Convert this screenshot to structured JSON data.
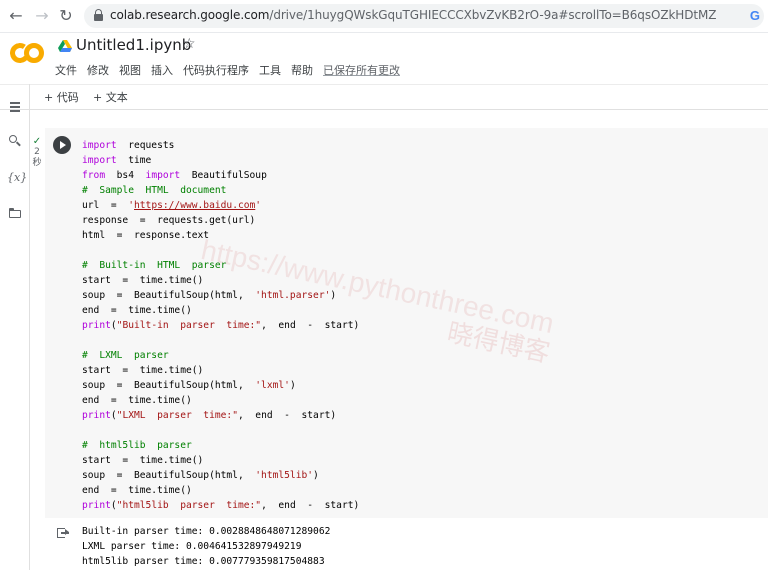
{
  "browser": {
    "back": "←",
    "forward": "→",
    "reload": "↻",
    "url_host": "colab.research.google.com",
    "url_path": "/drive/1huygQWskGquTGHIECCCXbvZvKB2rO-9a#scrollTo=B6qsOZkHDtMZ",
    "g_label": "G"
  },
  "header": {
    "notebook_title": "Untitled1.ipynb",
    "star": "☆",
    "menu": [
      "文件",
      "修改",
      "视图",
      "插入",
      "代码执行程序",
      "工具",
      "帮助"
    ],
    "saved_status": "已保存所有更改"
  },
  "toolbar": {
    "add_code": "+ 代码",
    "add_text": "+ 文本"
  },
  "rail": {
    "variables_label": "{x}"
  },
  "cell": {
    "status_check": "✓",
    "status_seconds": "2",
    "status_unit": "秒"
  },
  "code_lines": [
    [
      [
        "kw",
        "import"
      ],
      [
        "",
        "  requests"
      ]
    ],
    [
      [
        "kw",
        "import"
      ],
      [
        "",
        "  time"
      ]
    ],
    [
      [
        "kw",
        "from"
      ],
      [
        "",
        "  bs4  "
      ],
      [
        "kw",
        "import"
      ],
      [
        "",
        "  BeautifulSoup"
      ]
    ],
    [
      [
        "cm",
        "#  Sample  HTML  document"
      ]
    ],
    [
      [
        "",
        "url  =  "
      ],
      [
        "st",
        "'"
      ],
      [
        "lk",
        "https://www.baidu.com"
      ],
      [
        "st",
        "'"
      ]
    ],
    [
      [
        "",
        "response  =  requests.get(url)"
      ]
    ],
    [
      [
        "",
        "html  =  response.text"
      ]
    ],
    [
      [
        "",
        ""
      ]
    ],
    [
      [
        "cm",
        "#  Built-in  HTML  parser"
      ]
    ],
    [
      [
        "",
        "start  =  time.time()"
      ]
    ],
    [
      [
        "",
        "soup  =  BeautifulSoup(html,  "
      ],
      [
        "st",
        "'html.parser'"
      ],
      [
        "",
        ")"
      ]
    ],
    [
      [
        "",
        "end  =  time.time()"
      ]
    ],
    [
      [
        "kw",
        "print"
      ],
      [
        "",
        "("
      ],
      [
        "st",
        "\"Built-in  parser  time:\""
      ],
      [
        "",
        ",  end  -  start)"
      ]
    ],
    [
      [
        "",
        ""
      ]
    ],
    [
      [
        "cm",
        "#  LXML  parser"
      ]
    ],
    [
      [
        "",
        "start  =  time.time()"
      ]
    ],
    [
      [
        "",
        "soup  =  BeautifulSoup(html,  "
      ],
      [
        "st",
        "'lxml'"
      ],
      [
        "",
        ")"
      ]
    ],
    [
      [
        "",
        "end  =  time.time()"
      ]
    ],
    [
      [
        "kw",
        "print"
      ],
      [
        "",
        "("
      ],
      [
        "st",
        "\"LXML  parser  time:\""
      ],
      [
        "",
        ",  end  -  start)"
      ]
    ],
    [
      [
        "",
        ""
      ]
    ],
    [
      [
        "cm",
        "#  html5lib  parser"
      ]
    ],
    [
      [
        "",
        "start  =  time.time()"
      ]
    ],
    [
      [
        "",
        "soup  =  BeautifulSoup(html,  "
      ],
      [
        "st",
        "'html5lib'"
      ],
      [
        "",
        ")"
      ]
    ],
    [
      [
        "",
        "end  =  time.time()"
      ]
    ],
    [
      [
        "kw",
        "print"
      ],
      [
        "",
        "("
      ],
      [
        "st",
        "\"html5lib  parser  time:\""
      ],
      [
        "",
        ",  end  -  start)"
      ]
    ]
  ],
  "output_lines": [
    "Built-in parser time: 0.0028848648071289062",
    "LXML parser time: 0.004641532897949219",
    "html5lib parser time: 0.007779359817504883"
  ],
  "watermark": {
    "site": "https://www.pythonthree.com",
    "name": "晓得博客"
  },
  "colors": {
    "keyword": "#af00db",
    "comment": "#008000",
    "string": "#a31515",
    "logo": "#f9ab00"
  }
}
